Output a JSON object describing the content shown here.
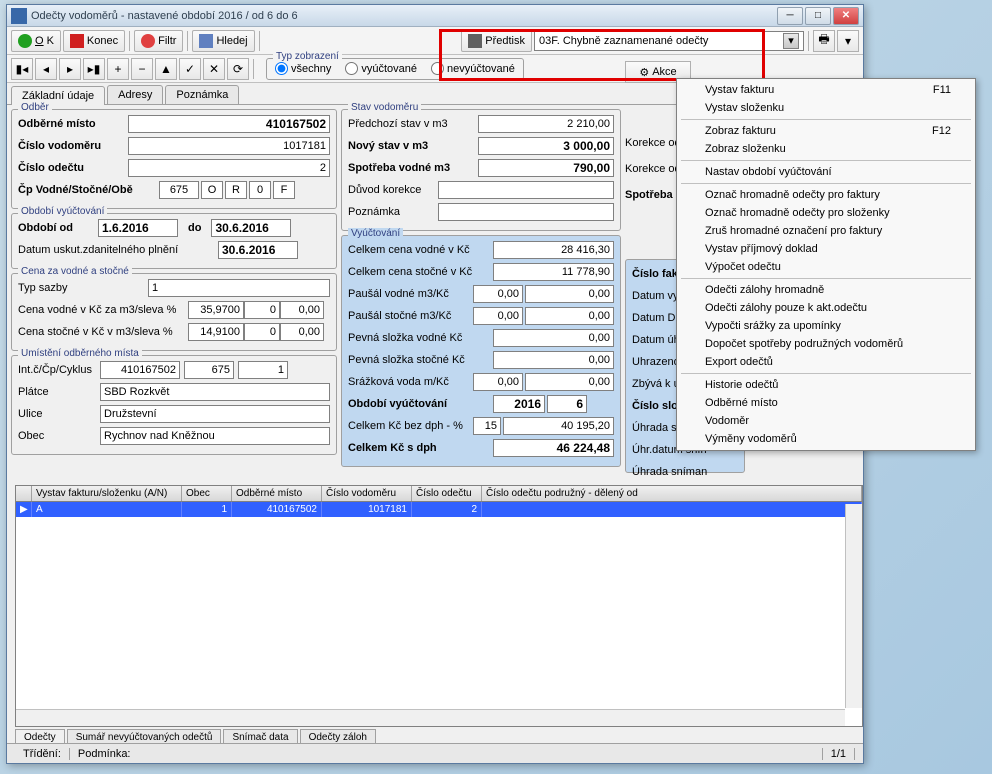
{
  "title": "Odečty vodoměrů - nastavené období 2016 / od 6 do 6",
  "toolbar": {
    "ok": "OK",
    "konec": "Konec",
    "filtr": "Filtr",
    "hledej": "Hledej",
    "predtisk": "Předtisk",
    "akce": "Akce"
  },
  "predtisk_combo": "03F. Chybně zaznamenané odečty",
  "typz": {
    "title": "Typ zobrazení",
    "r1": "všechny",
    "r2": "vyúčtované",
    "r3": "nevyúčtované"
  },
  "maintabs": {
    "t1": "Základní údaje",
    "t2": "Adresy",
    "t3": "Poznámka"
  },
  "odber": {
    "title": "Odběr",
    "misto_lbl": "Odběrné místo",
    "misto": "410167502",
    "cislovod_lbl": "Číslo vodoměru",
    "cislovod": "1017181",
    "cisloode_lbl": "Číslo odečtu",
    "cisloode": "2",
    "cp_lbl": "Čp Vodné/Stočné/Obě",
    "cp1": "675",
    "cp2": "O",
    "cp3": "R",
    "cp4": "0",
    "cp5": "F"
  },
  "obdobi": {
    "title": "Období vyúčtování",
    "od_lbl": "Období od",
    "od": "1.6.2016",
    "do_lbl": "do",
    "do": "30.6.2016",
    "datum_lbl": "Datum uskut.zdanitelného plnění",
    "datum": "30.6.2016"
  },
  "cena": {
    "title": "Cena za vodné a stočné",
    "typ_lbl": "Typ sazby",
    "typ": "1",
    "vodne_lbl": "Cena vodné v Kč za m3/sleva %",
    "vodne_c": "35,9700",
    "vodne_s": "0",
    "vodne_k": "0,00",
    "stocne_lbl": "Cena stočné v Kč v m3/sleva %",
    "stocne_c": "14,9100",
    "stocne_s": "0",
    "stocne_k": "0,00"
  },
  "umisteni": {
    "title": "Umístění odběrného místa",
    "intc_lbl": "Int.č/Čp/Cyklus",
    "intc": "410167502",
    "cp": "675",
    "cyk": "1",
    "platce_lbl": "Plátce",
    "platce": "SBD Rozkvět",
    "ulice_lbl": "Ulice",
    "ulice": "Družstevní",
    "obec_lbl": "Obec",
    "obec": "Rychnov nad Kněžnou"
  },
  "stav": {
    "title": "Stav vodoměru",
    "predch_lbl": "Předchozí stav v m3",
    "predch": "2 210,00",
    "novy_lbl": "Nový stav v m3",
    "novy": "3 000,00",
    "spotreba_lbl": "Spotřeba vodné m3",
    "spotreba": "790,00",
    "duvod_lbl": "Důvod korekce",
    "pozn_lbl": "Poznámka",
    "kor1": "Korekce odpočet vod",
    "kor2": "Korekce odpočet stoč",
    "kor3": "Spotřeba stočné m"
  },
  "vyuct": {
    "title": "Vyúčtování",
    "cvkc_lbl": "Celkem cena vodné v Kč",
    "cvkc": "28 416,30",
    "cskc_lbl": "Celkem cena stočné v Kč",
    "cskc": "11 778,90",
    "pv_lbl": "Paušál vodné m3/Kč",
    "pv1": "0,00",
    "pv2": "0,00",
    "ps_lbl": "Paušál stočné m3/Kč",
    "ps1": "0,00",
    "ps2": "0,00",
    "psv_lbl": "Pevná složka vodné Kč",
    "psv": "0,00",
    "pss_lbl": "Pevná složka stočné Kč",
    "pss": "0,00",
    "srv_lbl": "Srážková voda m/Kč",
    "srv1": "0,00",
    "srv2": "0,00",
    "obd_lbl": "Období vyúčtování",
    "obd1": "2016",
    "obd2": "6",
    "cbd_lbl": "Celkem Kč bez dph  - %",
    "cbd1": "15",
    "cbd2": "40 195,20",
    "csd_lbl": "Celkem Kč s dph",
    "csd": "46 224,48"
  },
  "right": {
    "cf": "Číslo faktur",
    "dv": "Datum vystave",
    "dd": "Datum DUZP",
    "du": "Datum úhrady",
    "uh": "Uhrazeno v Kč",
    "zb": "Zbývá k úhrac",
    "cs": "Číslo složen",
    "us": "Úhrada složen",
    "uds": "Úhr.datum snín",
    "usn": "Úhrada sníman"
  },
  "grid": {
    "headers": [
      "",
      "Vystav fakturu/složenku (A/N)",
      "Obec",
      "Odběrné místo",
      "Číslo vodoměru",
      "Číslo odečtu",
      "Číslo odečtu podružný - dělený od"
    ],
    "row": [
      "▶",
      "A",
      "1",
      "410167502",
      "1017181",
      "2",
      ""
    ]
  },
  "btabs": {
    "t1": "Odečty",
    "t2": "Sumář nevyúčtovaných odečtů",
    "t3": "Snímač data",
    "t4": "Odečty záloh"
  },
  "status": {
    "trideni": "Třídění:",
    "podminka": "Podmínka:",
    "pages": "1/1"
  },
  "menu": [
    {
      "label": "Vystav fakturu",
      "sc": "F11"
    },
    {
      "label": "Vystav složenku"
    },
    {
      "sep": true
    },
    {
      "label": "Zobraz fakturu",
      "sc": "F12"
    },
    {
      "label": "Zobraz složenku"
    },
    {
      "sep": true
    },
    {
      "label": "Nastav období vyúčtování"
    },
    {
      "sep": true
    },
    {
      "label": "Označ hromadně odečty pro  faktury"
    },
    {
      "label": "Označ hromadně odečty pro složenky"
    },
    {
      "label": "Zruš hromadné označení pro faktury"
    },
    {
      "label": "Vystav příjmový doklad"
    },
    {
      "label": "Výpočet odečtu"
    },
    {
      "sep": true
    },
    {
      "label": "Odečti zálohy hromadně"
    },
    {
      "label": "Odečti zálohy pouze k akt.odečtu"
    },
    {
      "label": "Vypočti srážky za upomínky"
    },
    {
      "label": "Dopočet spotřeby podružných vodoměrů"
    },
    {
      "label": "Export odečtů"
    },
    {
      "sep": true
    },
    {
      "label": "Historie odečtů"
    },
    {
      "label": "Odběrné místo"
    },
    {
      "label": "Vodoměr"
    },
    {
      "label": "Výměny vodoměrů"
    }
  ]
}
